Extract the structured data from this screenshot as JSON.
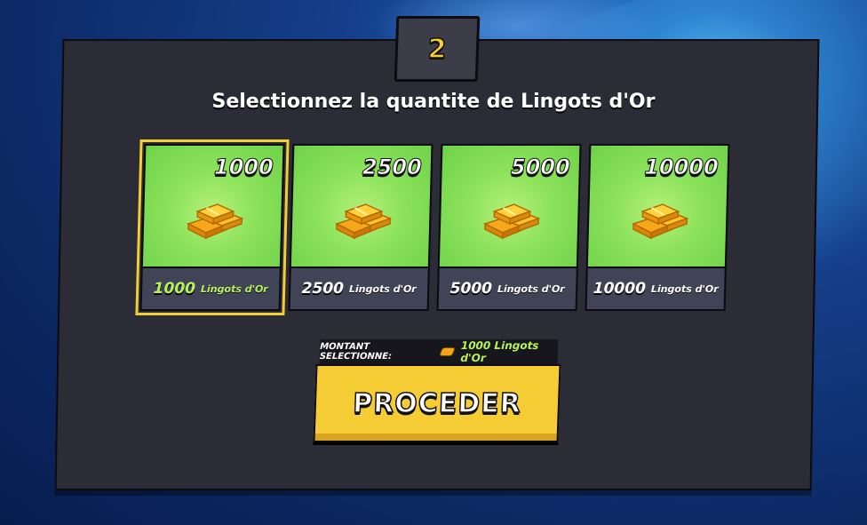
{
  "step": {
    "number": "2"
  },
  "title": "Selectionnez la quantite de Lingots d'Or",
  "cards": [
    {
      "amount": "1000",
      "label_num": "1000",
      "label_unit": "Lingots d'Or",
      "selected": true
    },
    {
      "amount": "2500",
      "label_num": "2500",
      "label_unit": "Lingots d'Or",
      "selected": false
    },
    {
      "amount": "5000",
      "label_num": "5000",
      "label_unit": "Lingots d'Or",
      "selected": false
    },
    {
      "amount": "10000",
      "label_num": "10000",
      "label_unit": "Lingots d'Or",
      "selected": false
    }
  ],
  "selection": {
    "label": "MONTANT SELECTIONNE:",
    "value": "1000 Lingots d'Or"
  },
  "proceed_button": {
    "label": "PROCEDER"
  },
  "colors": {
    "accent_yellow": "#f5cc33",
    "selected_green": "#b7f25c",
    "card_green": "#8be25a",
    "panel": "#2c2c36"
  },
  "icons": {
    "card_icon": "gold-bars-icon",
    "selection_icon": "gold-bar-icon"
  }
}
